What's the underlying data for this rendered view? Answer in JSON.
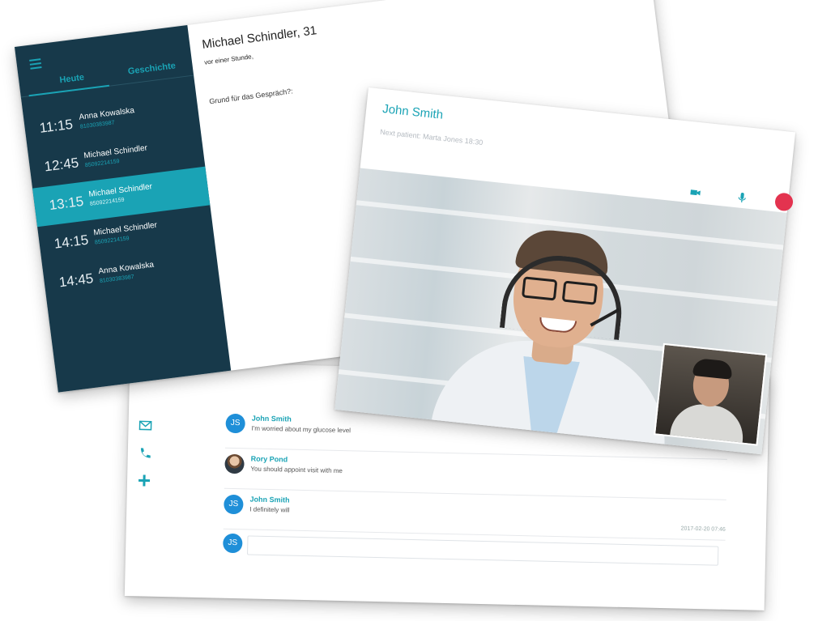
{
  "appointments_card": {
    "tabs": [
      "Heute",
      "Geschichte"
    ],
    "appointments": [
      {
        "time": "11:15",
        "name": "Anna Kowalska",
        "phone": "81030383987",
        "active": false
      },
      {
        "time": "12:45",
        "name": "Michael Schindler",
        "phone": "85092214159",
        "active": false
      },
      {
        "time": "13:15",
        "name": "Michael Schindler",
        "phone": "85092214159",
        "active": true
      },
      {
        "time": "14:15",
        "name": "Michael Schindler",
        "phone": "85092214159",
        "active": false
      },
      {
        "time": "14:45",
        "name": "Anna Kowalska",
        "phone": "81030383987",
        "active": false
      }
    ],
    "detail": {
      "title": "Michael Schindler, 31",
      "time_ago": "vor einer Stunde,",
      "reason_label": "Grund für das Gespräch?:"
    }
  },
  "video_card": {
    "caller_name": "John Smith",
    "next_patient": "Next patient: Marta Jones 18:30",
    "controls": [
      "video-camera-icon",
      "microphone-icon",
      "hang-up-icon"
    ],
    "hangup_color": "#e3334f"
  },
  "chat_card": {
    "side_icons": [
      "mail-icon",
      "phone-icon",
      "plus-icon"
    ],
    "messages": [
      {
        "initials": "JS",
        "sender": "John Smith",
        "text": "I'm worried about my glucose level",
        "timestamp": ""
      },
      {
        "initials": "",
        "sender": "Rory Pond",
        "text": "You should appoint visit with me",
        "timestamp": ""
      },
      {
        "initials": "JS",
        "sender": "John Smith",
        "text": "I definitely will",
        "timestamp": "2017-02-20 07:46"
      }
    ],
    "composer_initials": "JS"
  },
  "theme": {
    "accent": "#1aa3b5",
    "sidebar": "#17394a",
    "avatar": "#1f8fd8"
  }
}
